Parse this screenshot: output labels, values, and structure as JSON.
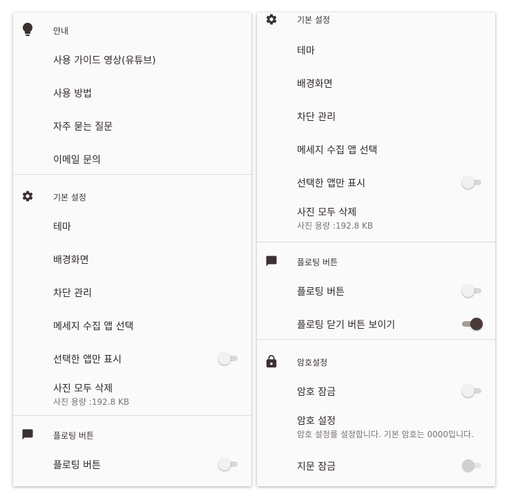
{
  "colors": {
    "icon": "#3a3230",
    "toggle_on_thumb": "#4a3b38",
    "toggle_on_track": "#a89b98",
    "divider": "#dcdcdc"
  },
  "left": {
    "guide": {
      "title": "안내",
      "icon": "lightbulb-icon",
      "items": [
        "사용 가이드 영상(유튜브)",
        "사용 방법",
        "자주 묻는 질문",
        "이메일 문의"
      ]
    },
    "basic": {
      "title": "기본 설정",
      "icon": "gear-icon",
      "theme": "테마",
      "wallpaper": "배경화면",
      "block": "차단 관리",
      "message_app": "메세지 수집 앱 선택",
      "selected_only": "선택한 앱만 표시",
      "selected_only_on": false,
      "delete_photos": "사진 모두 삭제",
      "photo_size": "사진 용량 :192.8 KB"
    },
    "floating": {
      "title": "플로팅 버튼",
      "icon": "chat-icon",
      "floating_button": "플로팅 버튼",
      "floating_button_on": false
    }
  },
  "right": {
    "basic": {
      "title": "기본 설정",
      "icon": "gear-icon",
      "theme": "테마",
      "wallpaper": "배경화면",
      "block": "차단 관리",
      "message_app": "메세지 수집 앱 선택",
      "selected_only": "선택한 앱만 표시",
      "selected_only_on": false,
      "delete_photos": "사진 모두 삭제",
      "photo_size": "사진 용량 :192.8 KB"
    },
    "floating": {
      "title": "플로팅 버튼",
      "icon": "chat-icon",
      "floating_button": "플로팅 버튼",
      "floating_button_on": false,
      "show_close": "플로팅 닫기 버튼 보이기",
      "show_close_on": true
    },
    "security": {
      "title": "암호설정",
      "icon": "lock-icon",
      "password_lock": "암호 잠금",
      "password_lock_on": false,
      "password_setting": "암호 설정",
      "password_setting_desc": "암호 설정를 설정합니다. 기본 암호는 0000입니다.",
      "fingerprint_lock": "지문 잠금",
      "fingerprint_lock_on": false
    }
  }
}
